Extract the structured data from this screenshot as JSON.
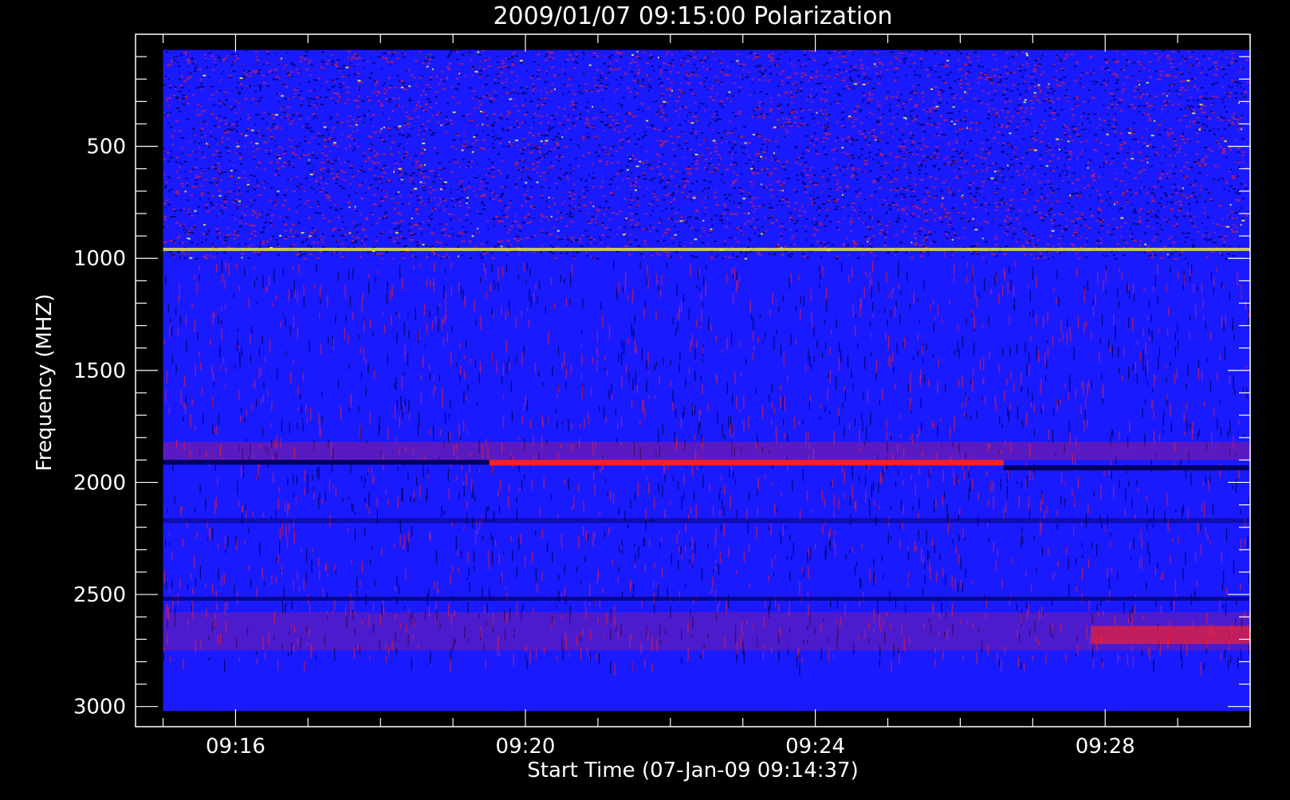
{
  "chart_data": {
    "type": "heatmap",
    "title": "2009/01/07 09:15:00 Polarization",
    "xlabel": "Start Time (07-Jan-09 09:14:37)",
    "ylabel": "Frequency (MHZ)",
    "x_ticks": [
      "09:16",
      "09:20",
      "09:24",
      "09:28"
    ],
    "x_tick_minutes": [
      16,
      20,
      24,
      28
    ],
    "x_range_minutes": [
      14.62,
      30.0
    ],
    "x_data_range_minutes": [
      15.0,
      30.0
    ],
    "y_ticks": [
      "500",
      "1000",
      "1500",
      "2000",
      "2500",
      "3000"
    ],
    "y_tick_values": [
      500,
      1000,
      1500,
      2000,
      2500,
      3000
    ],
    "y_range": [
      0,
      3090
    ],
    "y_data_range": [
      70,
      3020
    ],
    "y_reversed": true,
    "colors": {
      "background": "#000000",
      "base": "#1a1aff",
      "positive": "#ff2020",
      "negative": "#000060",
      "hot": "#ffff40",
      "axes": "#ffffff"
    },
    "features": [
      {
        "label": "noisy_band",
        "f_start": 70,
        "f_end": 1010
      },
      {
        "label": "bright_line",
        "f": 960
      },
      {
        "label": "red_emission",
        "f": 1910,
        "t_start": 19.5,
        "t_end": 26.6
      },
      {
        "label": "dark_line",
        "f": 1910,
        "t_start": 15.0,
        "t_end": 19.5
      },
      {
        "label": "dark_line",
        "f": 1935,
        "t_start": 26.6,
        "t_end": 30.0
      },
      {
        "label": "red_patch",
        "f_start": 2640,
        "f_end": 2720,
        "t_start": 27.8,
        "t_end": 30.0
      }
    ]
  }
}
